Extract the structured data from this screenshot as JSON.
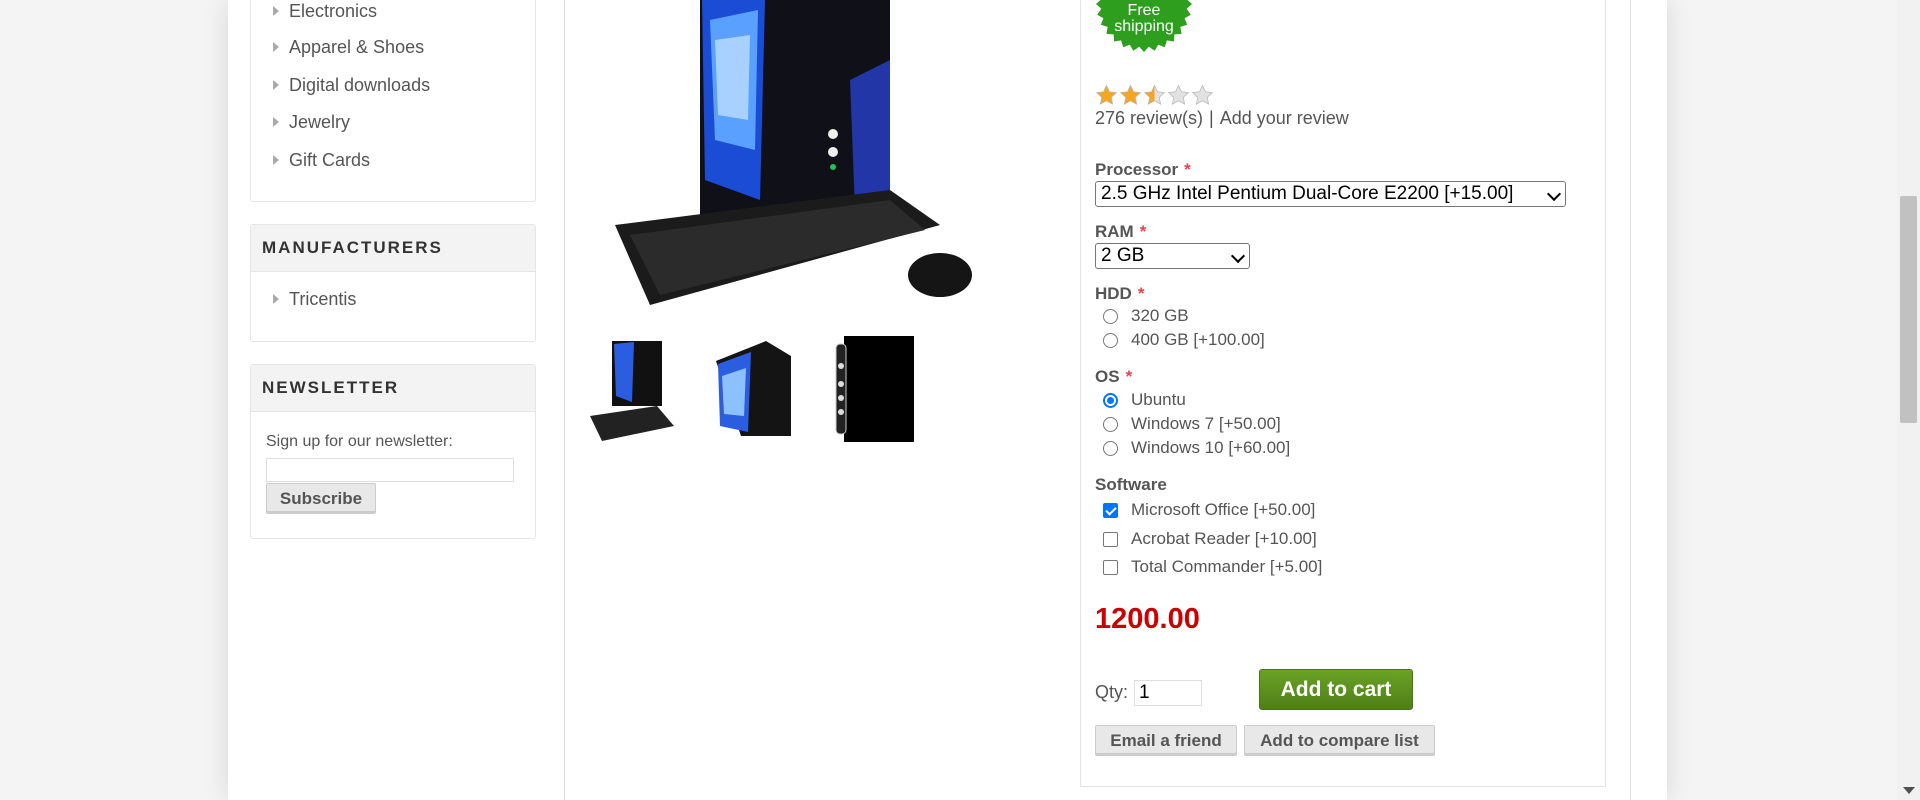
{
  "sidebar": {
    "categories": [
      "Electronics",
      "Apparel & Shoes",
      "Digital downloads",
      "Jewelry",
      "Gift Cards"
    ],
    "manufacturers_title": "MANUFACTURERS",
    "manufacturers": [
      "Tricentis"
    ],
    "newsletter_title": "NEWSLETTER",
    "newsletter_label": "Sign up for our newsletter:",
    "subscribe_label": "Subscribe"
  },
  "product": {
    "badge_text": "Free shipping",
    "rating_stars": 2.5,
    "rating_max": 5,
    "reviews_link": "276 review(s)",
    "review_separator": "|",
    "add_review_link": "Add your review",
    "price": "1200.00",
    "qty_label": "Qty:",
    "qty_value": "1",
    "add_to_cart_label": "Add to cart",
    "email_friend_label": "Email a friend",
    "compare_label": "Add to compare list",
    "required_mark": "*"
  },
  "attributes": {
    "processor": {
      "label": "Processor",
      "selected": "2.5 GHz Intel Pentium Dual-Core E2200 [+15.00]"
    },
    "ram": {
      "label": "RAM",
      "selected": "2 GB"
    },
    "hdd": {
      "label": "HDD",
      "options": [
        "320 GB",
        "400 GB [+100.00]"
      ],
      "checked_index": -1
    },
    "os": {
      "label": "OS",
      "options": [
        "Ubuntu",
        "Windows 7 [+50.00]",
        "Windows 10 [+60.00]"
      ],
      "checked_index": 0
    },
    "software": {
      "label": "Software",
      "options": [
        "Microsoft Office [+50.00]",
        "Acrobat Reader [+10.00]",
        "Total Commander [+5.00]"
      ],
      "checked": [
        true,
        false,
        false
      ]
    }
  },
  "colors": {
    "price": "#cc0000",
    "add_to_cart": "#5b8c1d",
    "required": "#e4444c",
    "badge": "#2e9e1f",
    "checkbox_on": "#0075ff"
  }
}
